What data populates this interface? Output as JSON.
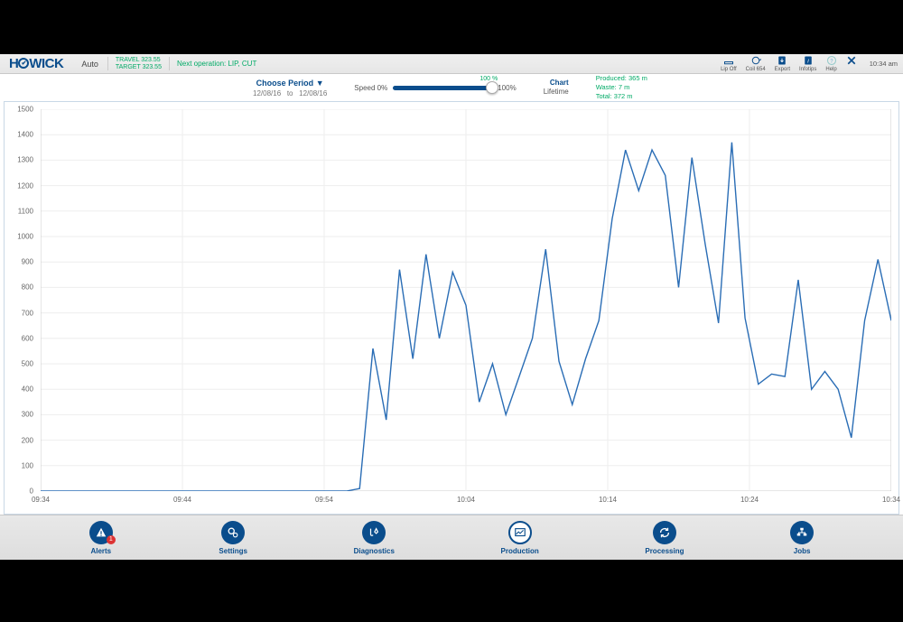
{
  "brand": "HOWICK",
  "mode": "Auto",
  "travel": {
    "label": "TRAVEL",
    "value": "323.55"
  },
  "target": {
    "label": "TARGET",
    "value": "323.55"
  },
  "next_op": {
    "label": "Next operation:",
    "value": "LIP, CUT"
  },
  "top_icons": {
    "lipoff": "Lip Off",
    "coil": "Coil 654",
    "export": "Export",
    "infotips": "Infotips",
    "help": "Help"
  },
  "clock": "10:34 am",
  "choose_period_label": "Choose Period",
  "date_from": "12/08/16",
  "date_to_word": "to",
  "date_to": "12/08/16",
  "speed_label_left": "Speed 0%",
  "speed_top": "100 %",
  "speed_right": "100%",
  "chart_word": "Chart",
  "lifetime_word": "Lifetime",
  "stats": {
    "produced": "Produced: 365 m",
    "waste": "Waste: 7 m",
    "total": "Total: 372 m"
  },
  "nav": {
    "alerts": "Alerts",
    "alerts_badge": "1",
    "settings": "Settings",
    "diagnostics": "Diagnostics",
    "production": "Production",
    "processing": "Processing",
    "jobs": "Jobs"
  },
  "chart_data": {
    "type": "line",
    "title": "",
    "xlabel": "",
    "ylabel": "",
    "ylim": [
      0,
      1500
    ],
    "y_ticks": [
      0,
      100,
      200,
      300,
      400,
      500,
      600,
      700,
      800,
      900,
      1000,
      1100,
      1200,
      1300,
      1400,
      1500
    ],
    "x_ticks": [
      "09:34",
      "09:44",
      "09:54",
      "10:04",
      "10:14",
      "10:24",
      "10:34"
    ],
    "x": [
      0,
      1,
      2,
      3,
      4,
      5,
      6,
      7,
      8,
      9,
      10,
      11,
      12,
      13,
      14,
      14.5,
      15,
      16,
      17,
      18,
      19,
      20,
      21,
      22,
      23,
      24,
      25,
      26,
      27,
      28,
      29,
      30,
      31,
      32,
      33,
      34,
      35,
      36,
      37,
      38,
      39,
      40,
      41,
      42,
      43,
      44,
      45,
      46,
      47,
      48,
      49,
      50,
      51,
      52,
      53,
      54,
      55,
      56,
      57,
      58,
      58.7,
      59.3,
      60
    ],
    "x_range": [
      0,
      60
    ],
    "values": [
      0,
      0,
      0,
      0,
      0,
      0,
      0,
      0,
      0,
      0,
      0,
      0,
      0,
      0,
      0,
      0,
      0,
      0,
      0,
      0,
      0,
      0,
      0,
      0,
      10,
      560,
      280,
      870,
      520,
      930,
      600,
      860,
      730,
      350,
      500,
      300,
      450,
      600,
      950,
      510,
      340,
      520,
      670,
      1070,
      1340,
      1180,
      1340,
      1240,
      800,
      1310,
      970,
      660,
      1370,
      680,
      420,
      460,
      450,
      830,
      400,
      470,
      400,
      210,
      670,
      910,
      670
    ]
  }
}
